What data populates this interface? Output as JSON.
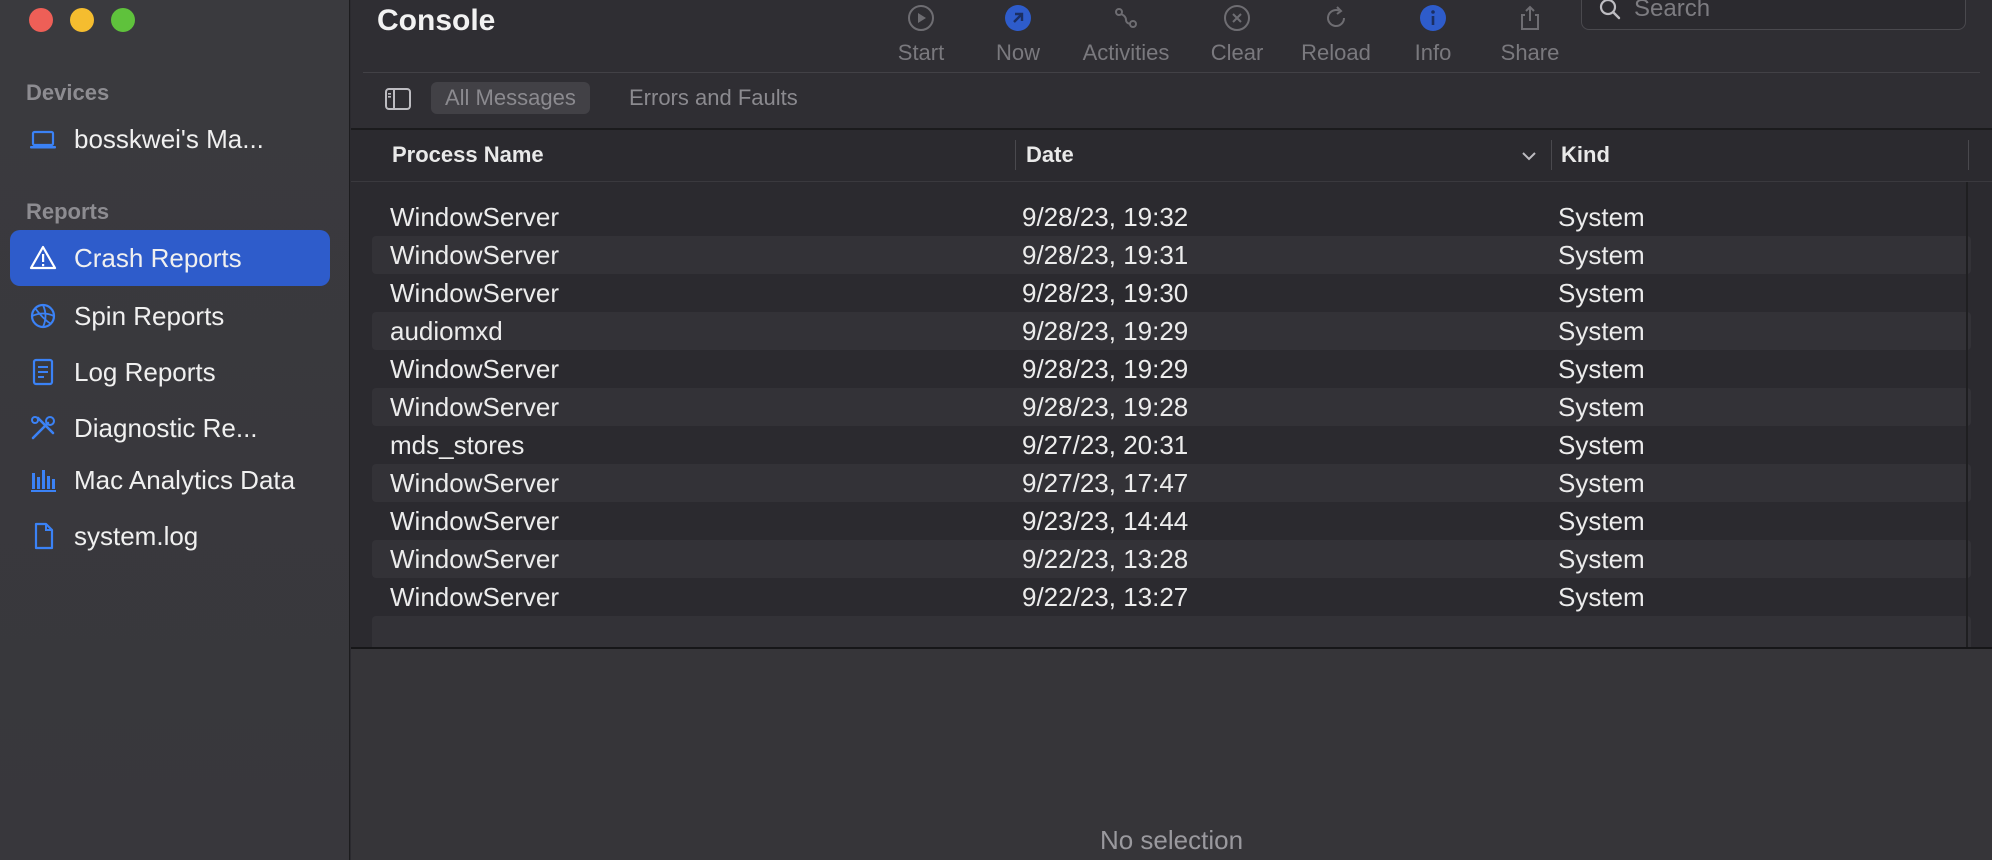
{
  "sidebar": {
    "devices_label": "Devices",
    "device_name": "bosskwei's Ma...",
    "reports_label": "Reports",
    "items": [
      {
        "label": "Crash Reports",
        "icon": "warning-icon",
        "active": true
      },
      {
        "label": "Spin Reports",
        "icon": "spin-icon",
        "active": false
      },
      {
        "label": "Log Reports",
        "icon": "log-icon",
        "active": false
      },
      {
        "label": "Diagnostic Re...",
        "icon": "tools-icon",
        "active": false
      },
      {
        "label": "Mac Analytics Data",
        "icon": "bar-chart-icon",
        "active": false
      },
      {
        "label": "system.log",
        "icon": "document-icon",
        "active": false
      }
    ]
  },
  "window": {
    "title": "Console"
  },
  "toolbar": {
    "start": "Start",
    "now": "Now",
    "activities": "Activities",
    "clear": "Clear",
    "reload": "Reload",
    "info": "Info",
    "share": "Share",
    "search_placeholder": "Search",
    "accent": "#2e5ccb"
  },
  "filters": {
    "all_messages": "All Messages",
    "errors_faults": "Errors and Faults"
  },
  "table": {
    "columns": [
      "Process Name",
      "Date",
      "Kind"
    ],
    "rows": [
      [
        "WindowServer",
        "9/28/23, 19:32",
        "System"
      ],
      [
        "WindowServer",
        "9/28/23, 19:31",
        "System"
      ],
      [
        "WindowServer",
        "9/28/23, 19:30",
        "System"
      ],
      [
        "audiomxd",
        "9/28/23, 19:29",
        "System"
      ],
      [
        "WindowServer",
        "9/28/23, 19:29",
        "System"
      ],
      [
        "WindowServer",
        "9/28/23, 19:28",
        "System"
      ],
      [
        "mds_stores",
        "9/27/23, 20:31",
        "System"
      ],
      [
        "WindowServer",
        "9/27/23, 17:47",
        "System"
      ],
      [
        "WindowServer",
        "9/23/23, 14:44",
        "System"
      ],
      [
        "WindowServer",
        "9/22/23, 13:28",
        "System"
      ],
      [
        "WindowServer",
        "9/22/23, 13:27",
        "System"
      ]
    ]
  },
  "detail": {
    "empty_text": "No selection"
  }
}
